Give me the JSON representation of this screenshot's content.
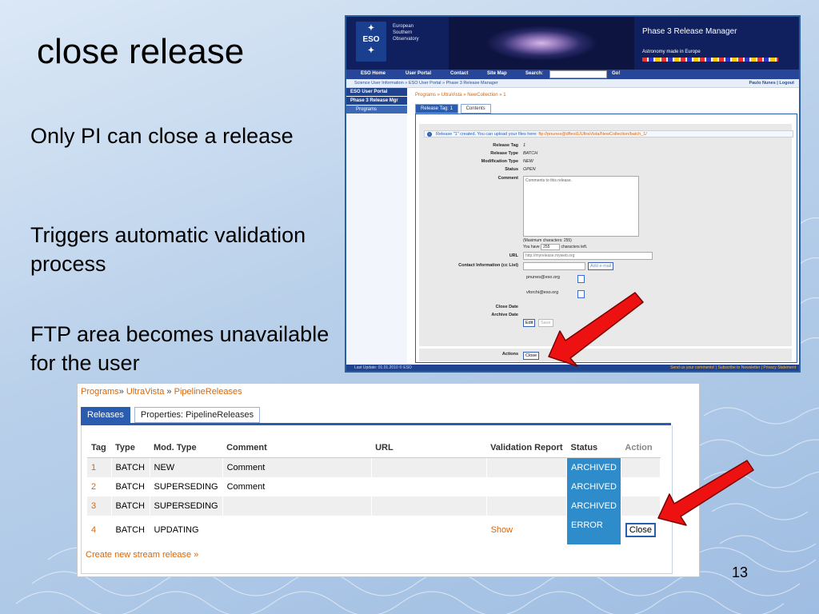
{
  "slide": {
    "title": "close release",
    "bullets": [
      "Only PI can close a release",
      "Triggers automatic validation process",
      "FTP area becomes unavailable for the user"
    ],
    "page_number": "13"
  },
  "top_screenshot": {
    "org_lines": [
      "European",
      "Southern",
      "Observatory"
    ],
    "logo_text": "ESO",
    "app_title": "Phase 3 Release Manager",
    "tagline": "Astronomy made in Europe",
    "nav": [
      "ESO Home",
      "User Portal",
      "Contact",
      "Site Map",
      "Search:",
      "Go!"
    ],
    "breadcrumb": "Science User Information » ESO User Portal » Phase 3 Release Manager",
    "user": "Paulo Nunes | Logout",
    "sidebar": [
      "ESO User Portal",
      "Phase 3 Release Mgr",
      "Programs"
    ],
    "path": "Programs » UltraVista » NewCollection » 1",
    "tabs": [
      "Release Tag: 1",
      "Contents"
    ],
    "info": "Release \"1\" created. You can upload your files here:",
    "ftp": "ftp://pnunes@dftest1/UltraVista/NewCollection/batch_1/",
    "fields": {
      "release_tag_label": "Release Tag",
      "release_tag": "1",
      "release_type_label": "Release Type",
      "release_type": "BATCH",
      "modification_type_label": "Modification Type",
      "modification_type": "NEW",
      "status_label": "Status",
      "status": "OPEN",
      "comment_label": "Comment",
      "comment_placeholder": "Comments to this release.",
      "max_chars": "(Maximum characters: 255)",
      "you_have": "You have",
      "chars_left_value": "255",
      "chars_left": "characters left.",
      "url_label": "URL",
      "url_value": "http://myrelease.myweb.org",
      "contact_label": "Contact Information (cc List)",
      "add_email": "Add e-mail",
      "emails": [
        "pnunes@eso.org",
        "vforchi@eso.org"
      ],
      "close_date_label": "Close Date",
      "archive_date_label": "Archive Date",
      "edit": "Edit",
      "save": "Save",
      "actions_label": "Actions",
      "close": "Close"
    },
    "footer_left": "Last Update: 01.01.2010 © ESO",
    "footer_right": "Send us your comments! | Subscribe to Newsletter | Privacy Statement"
  },
  "bottom_screenshot": {
    "path": [
      "Programs",
      "UltraVista",
      "PipelineReleases"
    ],
    "path_sep": "»",
    "tabs": [
      "Releases",
      "Properties: PipelineReleases"
    ],
    "columns": [
      "Tag",
      "Type",
      "Mod. Type",
      "Comment",
      "URL",
      "Validation Report",
      "Status",
      "Action"
    ],
    "rows": [
      {
        "tag": "1",
        "type": "BATCH",
        "mod_type": "NEW",
        "comment": "Comment",
        "url": "",
        "report": "",
        "status": "ARCHIVED",
        "action": ""
      },
      {
        "tag": "2",
        "type": "BATCH",
        "mod_type": "SUPERSEDING",
        "comment": "Comment",
        "url": "",
        "report": "",
        "status": "ARCHIVED",
        "action": ""
      },
      {
        "tag": "3",
        "type": "BATCH",
        "mod_type": "SUPERSEDING",
        "comment": "",
        "url": "",
        "report": "",
        "status": "ARCHIVED",
        "action": ""
      },
      {
        "tag": "4",
        "type": "BATCH",
        "mod_type": "UPDATING",
        "comment": "",
        "url": "",
        "report": "Show",
        "status": "ERROR",
        "action": "Close"
      }
    ],
    "create_link": "Create new stream release »"
  },
  "colors": {
    "accent": "#2a5db0",
    "link": "#d9660a",
    "status": "#2f8ccb",
    "arrow": "#ee1111"
  }
}
